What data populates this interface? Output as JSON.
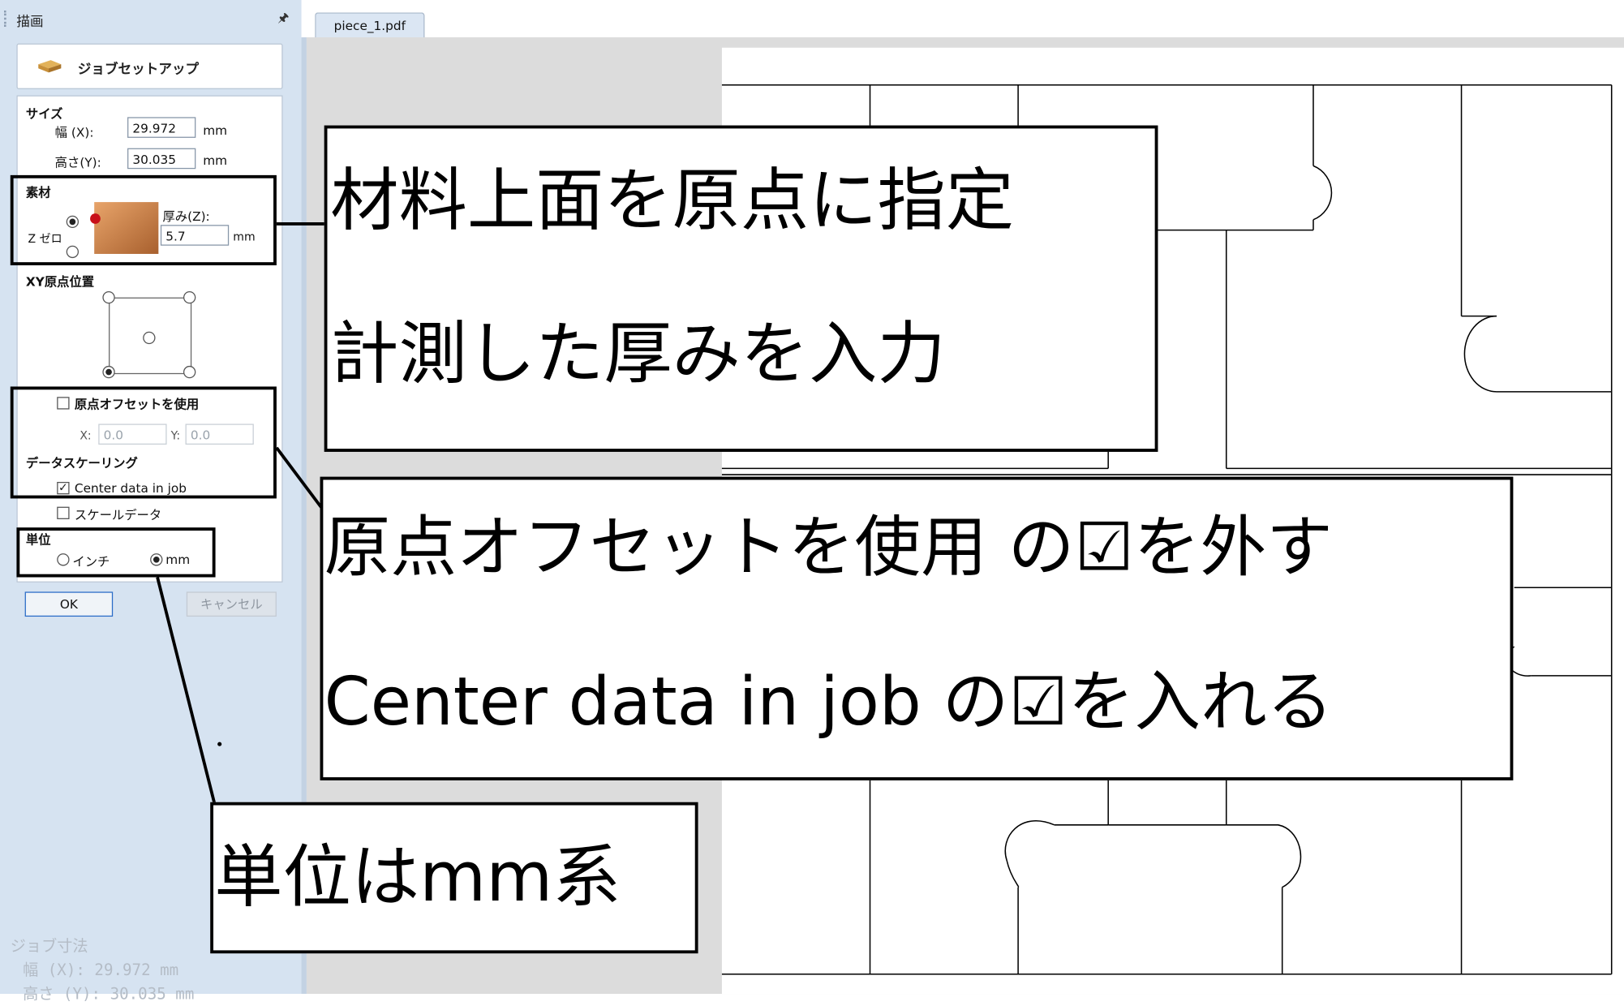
{
  "panel": {
    "title": "描画",
    "pin_glyph": "🖈",
    "job_setup": {
      "label": "ジョブセットアップ",
      "icon": "material-block-icon"
    },
    "size": {
      "heading": "サイズ",
      "width_label": "幅 (X):",
      "width_value": "29.972",
      "height_label": "高さ(Y):",
      "height_value": "30.035",
      "unit": "mm"
    },
    "material": {
      "heading": "素材",
      "zero_label": "Z ゼロ",
      "thickness_label": "厚み(Z):",
      "thickness_value": "5.7",
      "unit": "mm",
      "zero_top_selected": true
    },
    "xy_origin": {
      "heading": "XY原点位置",
      "selected_corner": "bottom-left"
    },
    "origin_offset": {
      "checkbox_label": "原点オフセットを使用",
      "checked": false,
      "x_label": "X:",
      "x_value": "0.0",
      "y_label": "Y:",
      "y_value": "0.0"
    },
    "data_scaling": {
      "heading": "データスケーリング",
      "center_label": "Center data in job",
      "center_checked": true,
      "scale_label": "スケールデータ",
      "scale_checked": false
    },
    "units": {
      "heading": "単位",
      "inch_label": "インチ",
      "mm_label": "mm",
      "selected": "mm"
    },
    "ok_label": "OK",
    "cancel_label": "キャンセル",
    "job_dimensions": {
      "heading": "ジョブ寸法",
      "width_line": "幅 (X): 29.972 mm",
      "height_line": "高さ (Y): 30.035 mm"
    }
  },
  "document": {
    "tab_label": "piece_1.pdf"
  },
  "annotations": {
    "callout1": {
      "line1": "材料上面を原点に指定",
      "line2": "計測した厚みを入力"
    },
    "callout2": {
      "line1": "原点オフセットを使用 の☑を外す",
      "line2": "Center data in job の☑を入れる"
    },
    "callout3": {
      "line1": "単位はmm系"
    }
  }
}
